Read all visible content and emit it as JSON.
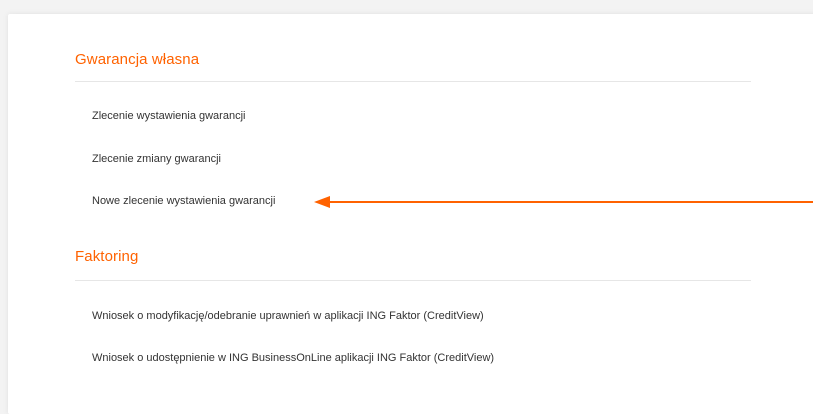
{
  "sections": [
    {
      "title": "Gwarancja własna",
      "items": [
        {
          "label": "Zlecenie wystawienia gwarancji"
        },
        {
          "label": "Zlecenie zmiany gwarancji"
        },
        {
          "label": "Nowe zlecenie wystawienia gwarancji"
        }
      ]
    },
    {
      "title": "Faktoring",
      "items": [
        {
          "label": "Wniosek o modyfikację/odebranie uprawnień w aplikacji ING Faktor (CreditView)"
        },
        {
          "label": "Wniosek o udostępnienie w ING BusinessOnLine aplikacji ING Faktor (CreditView)"
        }
      ]
    }
  ],
  "annotation": {
    "arrow_color": "#ff6200",
    "points_to": "Nowe zlecenie wystawienia gwarancji"
  },
  "colors": {
    "accent": "#ff6200",
    "text": "#333333",
    "divider": "#e6e6e6"
  }
}
